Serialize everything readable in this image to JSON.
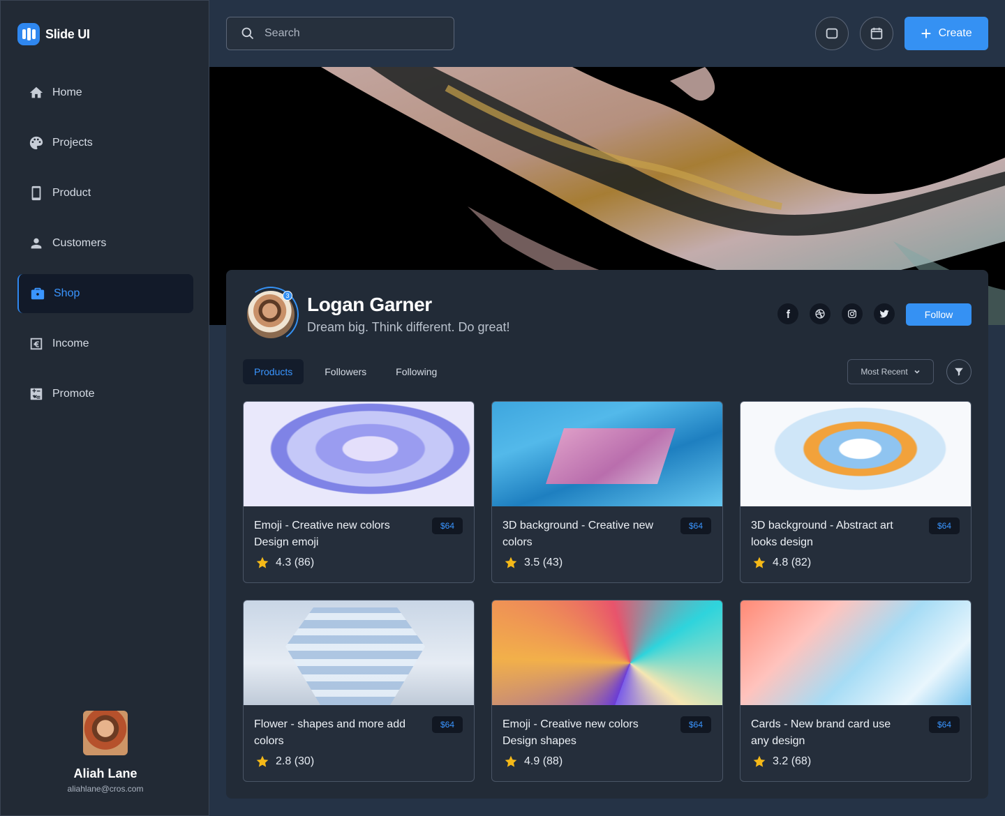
{
  "app": {
    "name": "Slide UI"
  },
  "sidebar": {
    "items": [
      {
        "label": "Home",
        "icon": "home-icon"
      },
      {
        "label": "Projects",
        "icon": "palette-icon"
      },
      {
        "label": "Product",
        "icon": "phone-icon"
      },
      {
        "label": "Customers",
        "icon": "person-icon"
      },
      {
        "label": "Shop",
        "icon": "briefcase-icon",
        "active": true
      },
      {
        "label": "Income",
        "icon": "euro-icon"
      },
      {
        "label": "Promote",
        "icon": "calculator-icon"
      }
    ],
    "user": {
      "name": "Aliah Lane",
      "email": "aliahlane@cros.com"
    }
  },
  "topbar": {
    "search_placeholder": "Search",
    "create_label": "Create"
  },
  "profile": {
    "name": "Logan Garner",
    "bio": "Dream big. Think different. Do great!",
    "badge_count": "3",
    "follow_label": "Follow",
    "socials": [
      "facebook-icon",
      "dribbble-icon",
      "instagram-icon",
      "twitter-icon"
    ]
  },
  "tabs": [
    "Products",
    "Followers",
    "Following"
  ],
  "sort": {
    "selected": "Most Recent"
  },
  "products": [
    {
      "title": "Emoji - Creative new colors Design emoji",
      "price": "$64",
      "rating": "4.3 (86)"
    },
    {
      "title": "3D background - Creative new colors",
      "price": "$64",
      "rating": "3.5 (43)"
    },
    {
      "title": "3D background - Abstract art looks design",
      "price": "$64",
      "rating": "4.8 (82)"
    },
    {
      "title": "Flower - shapes and more add colors",
      "price": "$64",
      "rating": "2.8 (30)"
    },
    {
      "title": "Emoji - Creative new colors Design shapes",
      "price": "$64",
      "rating": "4.9 (88)"
    },
    {
      "title": "Cards - New brand card use any design",
      "price": "$64",
      "rating": "3.2 (68)"
    }
  ],
  "colors": {
    "accent": "#3591f3",
    "star": "#f5b918"
  }
}
